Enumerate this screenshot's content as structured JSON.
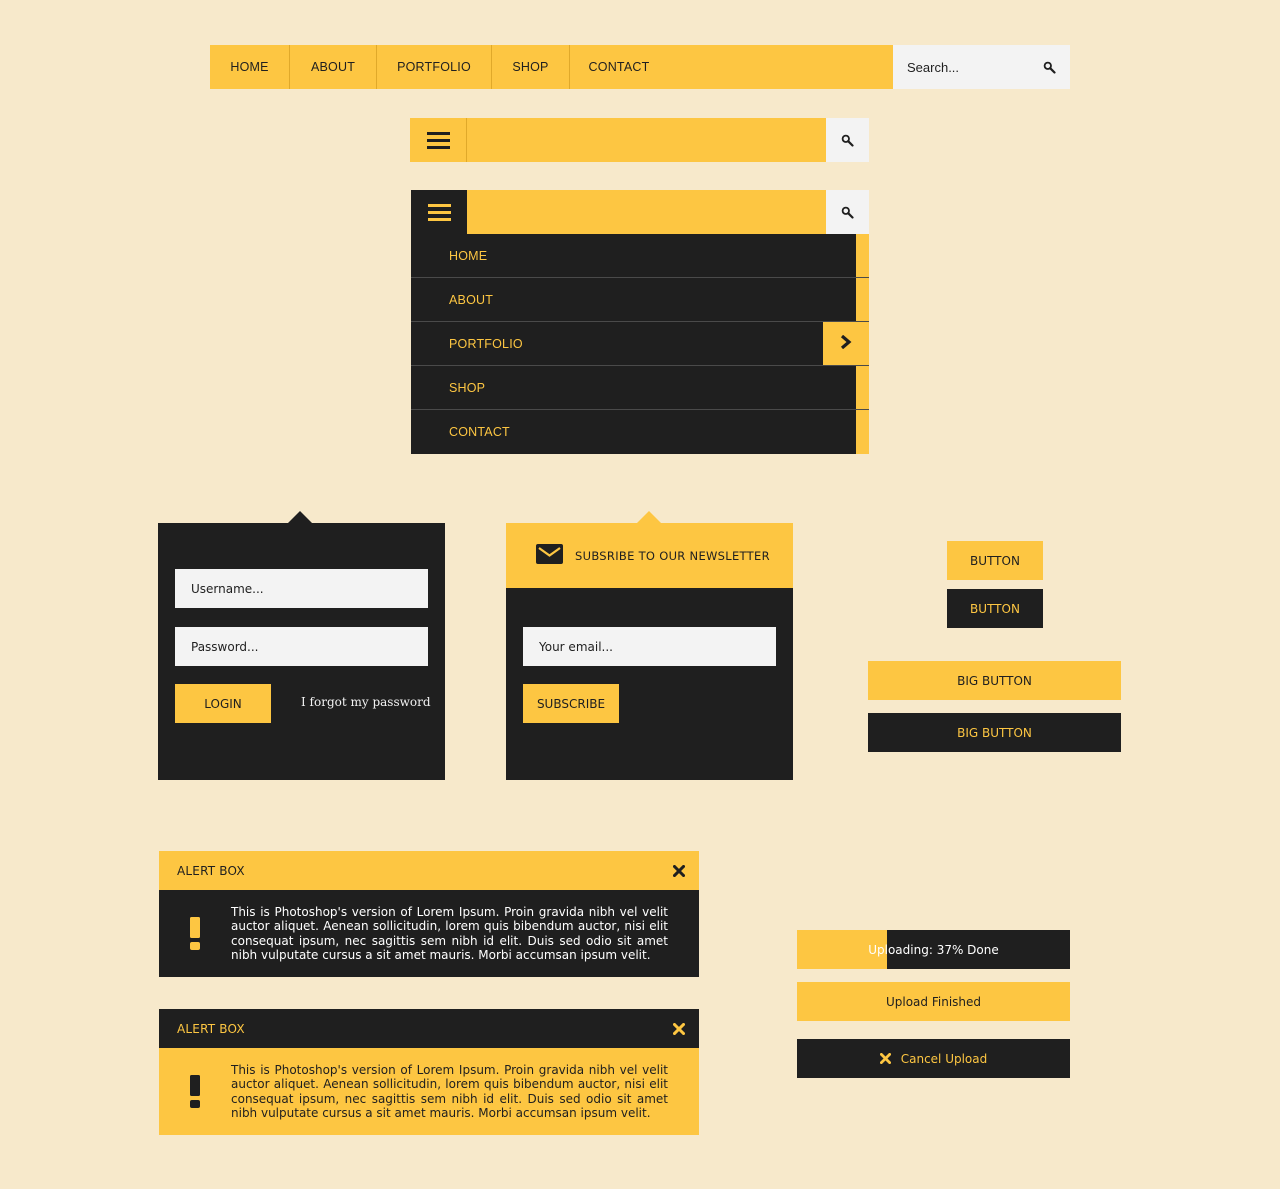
{
  "colors": {
    "background": "#f7e9cb",
    "accent": "#fdc642",
    "dark": "#1f1f1f",
    "light": "#f3f3f3"
  },
  "top_nav": {
    "items": [
      {
        "label": "HOME"
      },
      {
        "label": "ABOUT"
      },
      {
        "label": "PORTFOLIO"
      },
      {
        "label": "SHOP"
      },
      {
        "label": "CONTACT"
      }
    ],
    "search": {
      "placeholder": "Search...",
      "icon": "search-icon"
    }
  },
  "mobile_nav_collapsed": {
    "menu_icon": "hamburger-icon",
    "search_icon": "search-icon"
  },
  "mobile_nav_expanded": {
    "menu_icon": "hamburger-icon",
    "search_icon": "search-icon",
    "items": [
      {
        "label": "HOME",
        "active": false
      },
      {
        "label": "ABOUT",
        "active": false
      },
      {
        "label": "PORTFOLIO",
        "active": true,
        "icon": "chevron-right-icon"
      },
      {
        "label": "SHOP",
        "active": false
      },
      {
        "label": "CONTACT",
        "active": false
      }
    ]
  },
  "login": {
    "username_placeholder": "Username...",
    "password_placeholder": "Password...",
    "login_label": "LOGIN",
    "forgot_label": "I forgot my password"
  },
  "newsletter": {
    "icon": "envelope-icon",
    "title": "SUBSRIBE TO OUR NEWSLETTER",
    "email_placeholder": "Your email...",
    "subscribe_label": "SUBSCRIBE"
  },
  "buttons": {
    "small_yellow": "BUTTON",
    "small_dark": "BUTTON",
    "big_yellow": "BIG BUTTON",
    "big_dark": "BIG BUTTON"
  },
  "alerts": [
    {
      "title": "ALERT BOX",
      "icon": "exclamation-icon",
      "close_icon": "close-icon",
      "text": "This is Photoshop's version  of Lorem Ipsum. Proin gravida nibh vel velit auctor aliquet. Aenean sollicitudin, lorem quis bibendum auctor, nisi elit consequat ipsum, nec sagittis sem nibh id elit. Duis sed odio sit amet nibh vulputate cursus a sit amet mauris. Morbi accumsan ipsum velit."
    },
    {
      "title": "ALERT BOX",
      "icon": "exclamation-icon",
      "close_icon": "close-icon",
      "text": "This is Photoshop's version  of Lorem Ipsum. Proin gravida nibh vel velit auctor aliquet. Aenean sollicitudin, lorem quis bibendum auctor, nisi elit consequat ipsum, nec sagittis sem nibh id elit. Duis sed odio sit amet nibh vulputate cursus a sit amet mauris. Morbi accumsan ipsum velit."
    }
  ],
  "upload": {
    "progress_percent": 33,
    "progress_label": "Uploading: 37% Done",
    "finished_label": "Upload Finished",
    "cancel_label": "Cancel Upload",
    "cancel_icon": "close-icon"
  }
}
